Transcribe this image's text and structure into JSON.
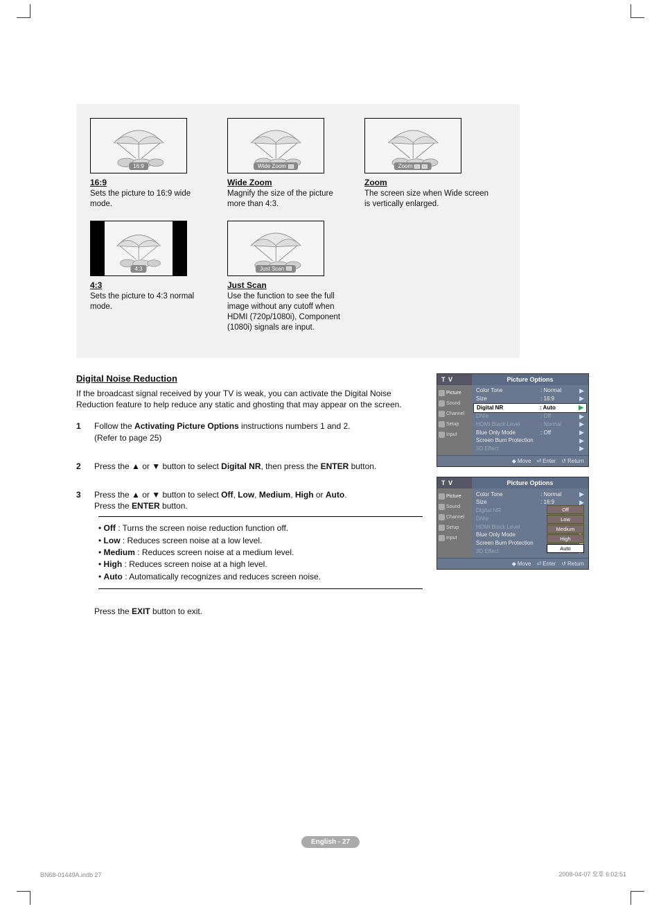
{
  "gallery": {
    "tiles": [
      {
        "badge": "16:9",
        "title": "16:9",
        "desc": "Sets the picture to 16:9 wide mode.",
        "aspect": "wide",
        "icons": 0
      },
      {
        "badge": "Wide Zoom",
        "title": "Wide Zoom",
        "desc": "Magnify the size of the picture more than 4:3.",
        "aspect": "wide",
        "icons": 1
      },
      {
        "badge": "Zoom",
        "title": "Zoom",
        "desc": "The screen size when Wide screen is vertically enlarged.",
        "aspect": "wide",
        "icons": 2
      },
      {
        "badge": "4:3",
        "title": "4:3",
        "desc": "Sets the picture to 4:3 normal mode.",
        "aspect": "narrow",
        "icons": 0
      },
      {
        "badge": "Just Scan",
        "title": "Just Scan",
        "desc": "Use the function to see the full image without any cutoff when HDMI (720p/1080i), Component (1080i) signals are input.",
        "aspect": "wide",
        "icons": 1
      }
    ]
  },
  "dnr": {
    "heading": "Digital Noise Reduction",
    "intro": "If the broadcast signal received by your TV is weak, you can activate the Digital Noise Reduction feature to help reduce any static and ghosting that may appear on the screen.",
    "steps": {
      "s1a": "Follow the ",
      "s1b": "Activating Picture Options",
      "s1c": " instructions numbers 1 and 2.",
      "s1d": "(Refer to page 25)",
      "s2a": "Press the ▲ or ▼ button to select ",
      "s2b": "Digital NR",
      "s2c": ", then press the ",
      "s2d": "ENTER",
      "s2e": " button.",
      "s3a": "Press the ▲ or ▼ button to select ",
      "s3b": "Off",
      "s3c": "Low",
      "s3d": "Medium",
      "s3e": "High",
      "s3f": "Auto",
      "s3g": ".",
      "s3h": "Press the ",
      "s3i": "ENTER",
      "s3j": " button."
    },
    "bullets": {
      "off": {
        "k": "Off",
        "v": " : Turns the screen noise reduction function off."
      },
      "low": {
        "k": "Low",
        "v": " : Reduces screen noise at a low level."
      },
      "medium": {
        "k": "Medium",
        "v": " : Reduces screen noise at a medium level."
      },
      "high": {
        "k": "High",
        "v": " : Reduces screen noise at a high level."
      },
      "auto": {
        "k": "Auto",
        "v": " : Automatically recognizes and reduces screen noise."
      }
    },
    "exit_a": "Press the ",
    "exit_b": "EXIT",
    "exit_c": " button to exit."
  },
  "osd": {
    "tv": "T V",
    "title": "Picture Options",
    "side": [
      "Picture",
      "Sound",
      "Channel",
      "Setup",
      "Input"
    ],
    "rows1": [
      {
        "k": "Color Tone",
        "v": ": Normal",
        "sel": false
      },
      {
        "k": "Size",
        "v": ": 16:9",
        "sel": false
      },
      {
        "k": "Digital NR",
        "v": ": Auto",
        "sel": true
      },
      {
        "k": "DNIe",
        "v": ": Off",
        "sel": false,
        "dim": true
      },
      {
        "k": "HDMI Black Level",
        "v": ": Normal",
        "sel": false,
        "dim": true
      },
      {
        "k": "Blue Only Mode",
        "v": ": Off",
        "sel": false
      },
      {
        "k": "Screen Burn Protection",
        "v": "",
        "sel": false
      },
      {
        "k": "3D Effect",
        "v": "",
        "sel": false,
        "dim": true
      }
    ],
    "rows2": [
      {
        "k": "Color Tone",
        "v": ": Normal"
      },
      {
        "k": "Size",
        "v": ": 16:9"
      },
      {
        "k": "Digital NR",
        "v": "",
        "dim": true
      },
      {
        "k": "DNIe",
        "v": "",
        "dim": true
      },
      {
        "k": "HDMI Black Level",
        "v": "",
        "dim": true
      },
      {
        "k": "Blue Only Mode",
        "v": ""
      },
      {
        "k": "Screen Burn Protection",
        "v": ""
      },
      {
        "k": "3D Effect",
        "v": "",
        "dim": true
      }
    ],
    "opts": [
      "Off",
      "Low",
      "Medium",
      "High",
      "Auto"
    ],
    "opts_sel": "Auto",
    "foot": {
      "move": "Move",
      "enter": "Enter",
      "return": "Return"
    }
  },
  "footer": {
    "page": "English - 27",
    "doc_left": "BN68-01449A.indb   27",
    "doc_right": "2008-04-07   오후 6:02:51"
  }
}
